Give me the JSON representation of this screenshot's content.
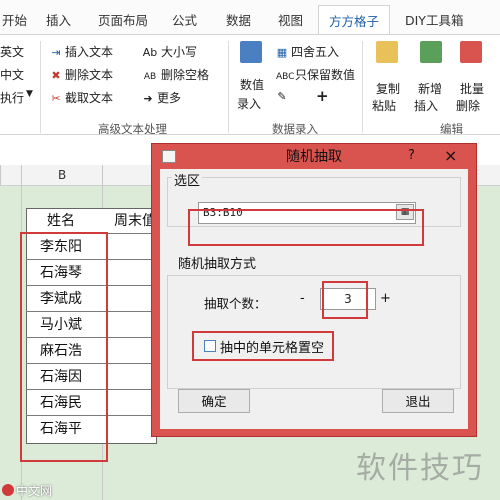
{
  "tabs": [
    "开始",
    "插入",
    "页面布局",
    "公式",
    "数据",
    "视图",
    "方方格子",
    "DIY工具箱"
  ],
  "ribbon": {
    "left_items": [
      "英文",
      "中文",
      "执行"
    ],
    "insert_text": "插入文本",
    "delete_text": "删除文本",
    "extract_text": "截取文本",
    "case": "大小写",
    "delete_spaces": "删除空格",
    "more": "更多",
    "group_text": "高级文本处理",
    "numeric_entry_line1": "数值",
    "numeric_entry_line2": "录入",
    "round": "四舍五入",
    "keep_value": "只保留数值",
    "plus": "+",
    "group_entry": "数据录入",
    "copy_line1": "复制",
    "copy_line2": "粘贴",
    "insert_line1": "新增",
    "insert_line2": "插入",
    "delete_line1": "批量",
    "delete_line2": "删除",
    "group_edit": "编辑"
  },
  "sheet": {
    "column_b": "B",
    "header_name": "姓名",
    "header_week": "周末值",
    "names": [
      "李东阳",
      "石海琴",
      "李斌成",
      "马小斌",
      "麻石浩",
      "石海因",
      "石海民",
      "石海平"
    ]
  },
  "dialog": {
    "title": "随机抽取",
    "help": "?",
    "close": "×",
    "range_label": "选区",
    "range_value": "B3:B10",
    "method_label": "随机抽取方式",
    "count_label": "抽取个数：",
    "minus": "-",
    "count_value": "3",
    "plus": "+",
    "clear_checkbox": "抽中的单元格置空",
    "ok": "确定",
    "exit": "退出"
  },
  "watermarks": {
    "software": "软件技巧",
    "site": "中文网"
  },
  "colors": {
    "dialog_frame": "#d9534f",
    "highlight": "#d03a3a",
    "sheet_bg": "#dcebd8"
  }
}
